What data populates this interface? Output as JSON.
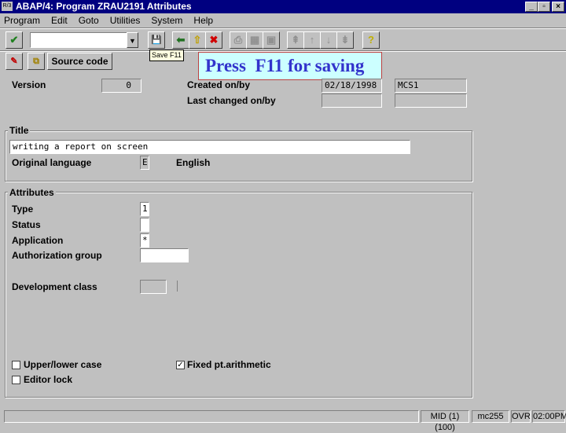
{
  "window": {
    "title": "ABAP/4: Program ZRAU2191 Attributes",
    "app_icon": "R/3",
    "min": "_",
    "restore": "▫",
    "close": "×"
  },
  "menu": [
    "Program",
    "Edit",
    "Goto",
    "Utilities",
    "System",
    "Help"
  ],
  "toolbar": {
    "command_value": "",
    "tooltip": "Save  F11"
  },
  "app_toolbar": {
    "source_code": "Source code"
  },
  "callout": {
    "text": "Press  F11 for saving",
    "color": "#3333cc"
  },
  "header": {
    "version_label": "Version",
    "version": "0",
    "created_label": "Created on/by",
    "created_date": "02/18/1998",
    "created_by": "MCS1",
    "changed_label": "Last changed on/by",
    "changed_date": "",
    "changed_by": ""
  },
  "title_group": {
    "title": "Title",
    "value": "writing a report on screen",
    "lang_label": "Original language",
    "lang_code": "E",
    "lang_name": "English"
  },
  "attributes": {
    "title": "Attributes",
    "type_label": "Type",
    "type": "1",
    "status_label": "Status",
    "status": "",
    "application_label": "Application",
    "application": "*",
    "auth_label": "Authorization group",
    "auth": "",
    "devclass_label": "Development class",
    "devclass": "",
    "upper_lower_label": "Upper/lower case",
    "upper_lower": false,
    "fixed_pt_label": "Fixed pt.arithmetic",
    "fixed_pt": true,
    "editor_lock_label": "Editor lock",
    "editor_lock": false
  },
  "status_bar": {
    "message": "",
    "system": "MID (1)(100)",
    "server": "mc255",
    "mode": "OVR",
    "time": "02:00PM"
  }
}
